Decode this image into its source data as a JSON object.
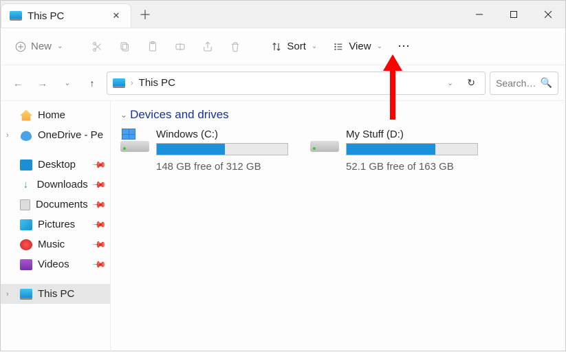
{
  "window": {
    "tab_title": "This PC",
    "new_button": "New",
    "sort_button": "Sort",
    "view_button": "View"
  },
  "address": {
    "location": "This PC"
  },
  "search": {
    "placeholder": "Search This PC"
  },
  "sidebar": {
    "home": "Home",
    "onedrive": "OneDrive - Pe",
    "desktop": "Desktop",
    "downloads": "Downloads",
    "documents": "Documents",
    "pictures": "Pictures",
    "music": "Music",
    "videos": "Videos",
    "this_pc": "This PC"
  },
  "content": {
    "section_title": "Devices and drives",
    "drives": [
      {
        "name": "Windows (C:)",
        "free_text": "148 GB free of 312 GB",
        "fill_pct": 52
      },
      {
        "name": "My Stuff (D:)",
        "free_text": "52.1 GB free of 163 GB",
        "fill_pct": 68
      }
    ]
  }
}
